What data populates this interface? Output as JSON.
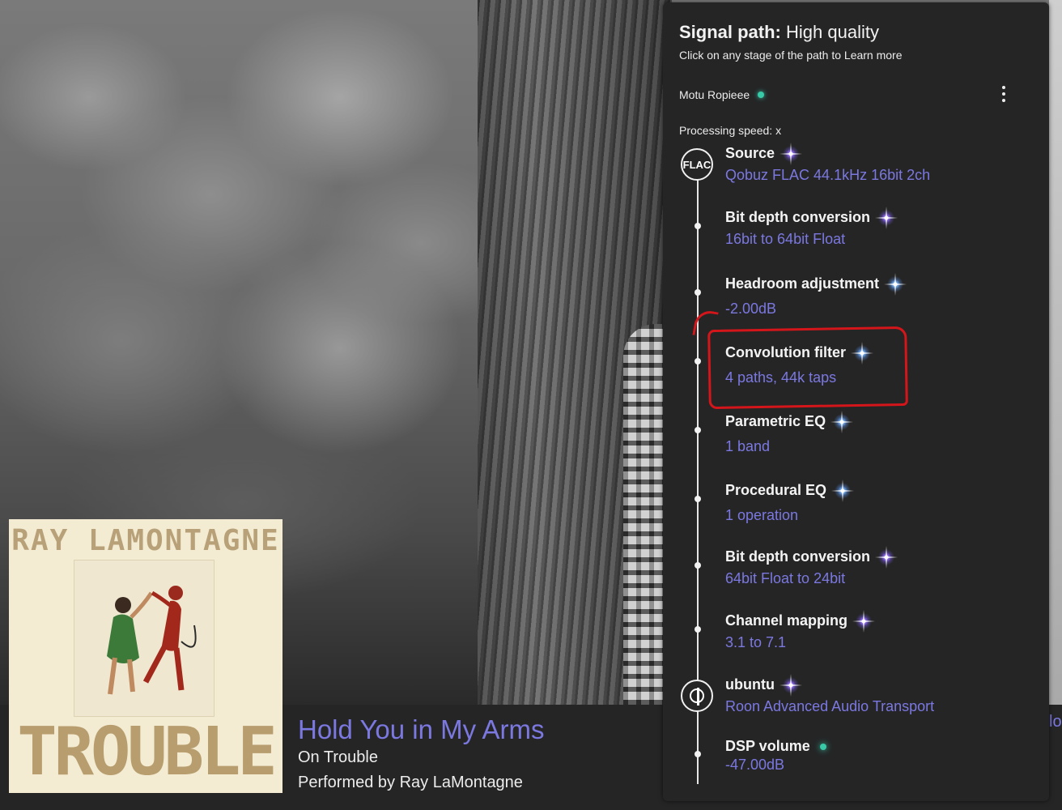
{
  "panel": {
    "heading_bold": "Signal path:",
    "heading_rest": " High quality",
    "subtitle": "Click on any stage of the path to Learn more",
    "zone_name": "Motu Ropieee",
    "processing_speed": "Processing speed: x",
    "source_badge": "FLAC",
    "stages": [
      {
        "title": "Source",
        "value": "Qobuz FLAC 44.1kHz 16bit 2ch",
        "quality": "purple-star"
      },
      {
        "title": "Bit depth conversion",
        "value": "16bit to 64bit Float",
        "quality": "purple-star"
      },
      {
        "title": "Headroom adjustment",
        "value": "-2.00dB",
        "quality": "blue-star"
      },
      {
        "title": "Convolution filter",
        "value": "4 paths, 44k taps",
        "quality": "blue-star"
      },
      {
        "title": "Parametric EQ",
        "value": "1 band",
        "quality": "blue-star"
      },
      {
        "title": "Procedural EQ",
        "value": "1 operation",
        "quality": "blue-star"
      },
      {
        "title": "Bit depth conversion",
        "value": "64bit Float to 24bit",
        "quality": "purple-star"
      },
      {
        "title": "Channel mapping",
        "value": "3.1 to 7.1",
        "quality": "purple-star"
      },
      {
        "title": "ubuntu",
        "value": "Roon Advanced Audio Transport",
        "quality": "purple-star"
      },
      {
        "title": "DSP volume",
        "value": "-47.00dB",
        "quality": "teal-dot"
      }
    ]
  },
  "now_playing": {
    "track_title": "Hold You in My Arms",
    "album_line": "On Trouble",
    "artist_line": "Performed by Ray LaMontagne",
    "cover_artist": "RAY LAMONTAGNE",
    "cover_title": "TROUBLE",
    "edge_text": "lo"
  },
  "colors": {
    "accent": "#7b78e0",
    "panel_bg": "#252526",
    "annotation": "#d4161b",
    "teal": "#38c9a8"
  }
}
